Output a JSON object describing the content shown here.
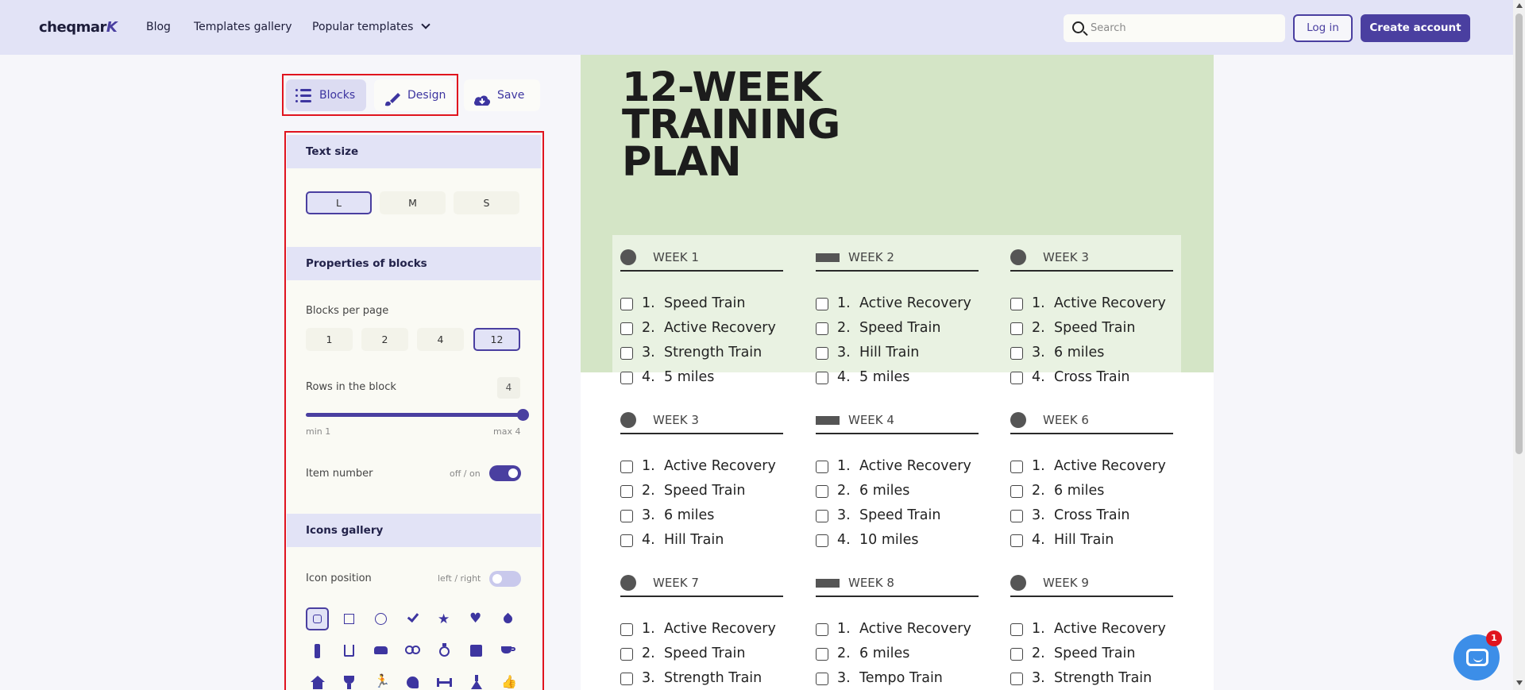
{
  "header": {
    "logo_text": "cheqmar",
    "logo_accent": "K",
    "nav": [
      "Blog",
      "Templates gallery",
      "Popular templates"
    ],
    "search_placeholder": "Search",
    "login_label": "Log in",
    "create_label": "Create account"
  },
  "tabs": {
    "blocks": "Blocks",
    "design": "Design",
    "save": "Save"
  },
  "panel": {
    "text_size": {
      "heading": "Text size",
      "options": [
        "L",
        "M",
        "S"
      ],
      "selected": "L"
    },
    "properties": {
      "heading": "Properties of blocks",
      "blocks_per_page_label": "Blocks per page",
      "blocks_options": [
        "1",
        "2",
        "4",
        "12"
      ],
      "blocks_selected": "12",
      "rows_label": "Rows in the block",
      "rows_value": "4",
      "rows_min": "min 1",
      "rows_max": "max 4",
      "item_number_label": "Item number",
      "item_number_toggle": "off / on",
      "item_number_on": true
    },
    "icons_gallery": {
      "heading": "Icons gallery",
      "position_label": "Icon position",
      "position_toggle": "left / right",
      "icons": [
        "rounded-square",
        "square",
        "circle",
        "check",
        "star",
        "heart",
        "drop",
        "bottle",
        "glass",
        "car",
        "rings",
        "ring",
        "film",
        "cup",
        "house",
        "trophy",
        "runner",
        "arm",
        "dumbbell",
        "flask",
        "thumbs-up"
      ]
    }
  },
  "doc": {
    "title_lines": [
      "12-WEEK",
      "TRAINING",
      "PLAN"
    ],
    "weeks": [
      {
        "title": "WEEK 1",
        "bullet": "dot",
        "items": [
          "Speed Train",
          "Active Recovery",
          "Strength Train",
          "5 miles"
        ]
      },
      {
        "title": "WEEK 2",
        "bullet": "bar",
        "items": [
          "Active Recovery",
          "Speed Train",
          "Hill Train",
          "5 miles"
        ]
      },
      {
        "title": "WEEK 3",
        "bullet": "dot",
        "items": [
          "Active Recovery",
          "Speed Train",
          "6 miles",
          "Cross Train"
        ]
      },
      {
        "title": "WEEK 3",
        "bullet": "dot",
        "items": [
          "Active Recovery",
          "Speed Train",
          "6 miles",
          "Hill Train"
        ]
      },
      {
        "title": "WEEK 4",
        "bullet": "bar",
        "items": [
          "Active Recovery",
          "6 miles",
          "Speed Train",
          "10 miles"
        ]
      },
      {
        "title": "WEEK 6",
        "bullet": "dot",
        "items": [
          "Active Recovery",
          "6 miles",
          "Cross Train",
          "Hill Train"
        ]
      },
      {
        "title": "WEEK 7",
        "bullet": "dot",
        "items": [
          "Active Recovery",
          "Speed Train",
          "Strength Train"
        ]
      },
      {
        "title": "WEEK 8",
        "bullet": "bar",
        "items": [
          "Active Recovery",
          "6 miles",
          "Tempo Train"
        ]
      },
      {
        "title": "WEEK 9",
        "bullet": "dot",
        "items": [
          "Active Recovery",
          "Speed Train",
          "Strength Train"
        ]
      }
    ]
  },
  "chat": {
    "badge_count": "1"
  },
  "colors": {
    "accent": "#4a3fa0",
    "header_bg": "#e2e3f6",
    "doc_band": "#d4e5c6",
    "highlight": "#e0141e"
  }
}
